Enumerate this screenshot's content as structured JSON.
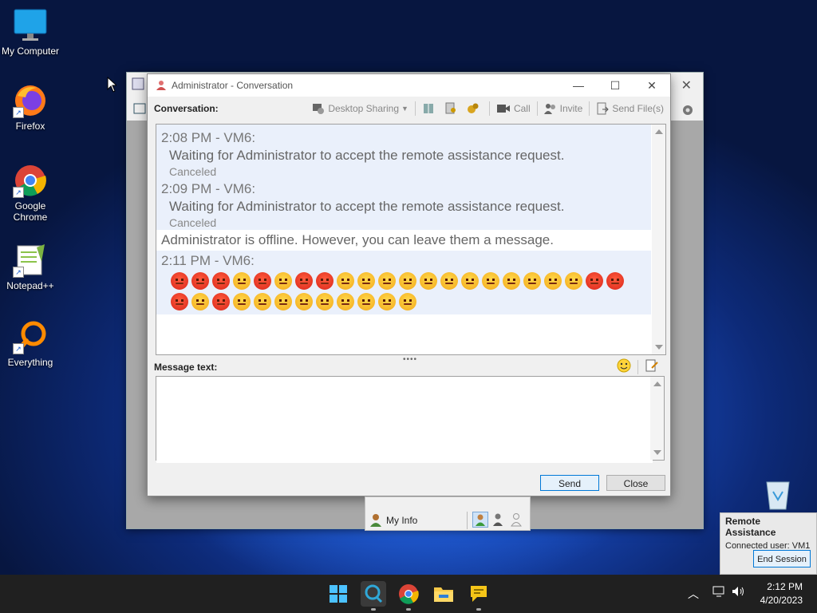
{
  "desktop": {
    "icons": [
      {
        "label": "My Computer"
      },
      {
        "label": "Firefox"
      },
      {
        "label": "Google Chrome"
      },
      {
        "label": "Notepad++"
      },
      {
        "label": "Everything"
      }
    ]
  },
  "conversation_window": {
    "title": "Administrator - Conversation",
    "toolbar": {
      "label": "Conversation:",
      "desktop_sharing": "Desktop Sharing",
      "call": "Call",
      "invite": "Invite",
      "send_files": "Send File(s)"
    },
    "messages": [
      {
        "header": "2:08 PM - VM6:",
        "body": "Waiting for Administrator to accept the remote assistance request.",
        "status": "Canceled"
      },
      {
        "header": "2:09 PM - VM6:",
        "body": "Waiting for Administrator to accept the remote assistance request.",
        "status": "Canceled"
      }
    ],
    "offline_notice": "Administrator is offline. However, you can leave them a message.",
    "emoji_message": {
      "header": "2:11 PM - VM6:",
      "row1": [
        "angry",
        "angry",
        "angry",
        "meh",
        "angry",
        "meh",
        "angry",
        "angry",
        "meh",
        "meh",
        "meh",
        "meh",
        "meh",
        "meh",
        "meh",
        "meh",
        "meh",
        "meh",
        "meh",
        "meh",
        "angry",
        "angry"
      ],
      "row2": [
        "angry",
        "meh",
        "angry",
        "meh",
        "meh",
        "meh",
        "meh",
        "meh",
        "meh",
        "meh",
        "meh",
        "meh"
      ]
    },
    "message_label": "Message text:",
    "message_value": "",
    "send_label": "Send",
    "close_label": "Close"
  },
  "my_info": {
    "label": "My Info"
  },
  "notification": {
    "title": "Remote Assistance",
    "connected_user": "Connected user:  VM1",
    "end_session": "End Session"
  },
  "taskbar": {
    "time": "2:12 PM",
    "date": "4/20/2023"
  },
  "colors": {
    "accent": "#0078d7",
    "message_bg": "#eaf0fb",
    "taskbar": "#202020"
  }
}
